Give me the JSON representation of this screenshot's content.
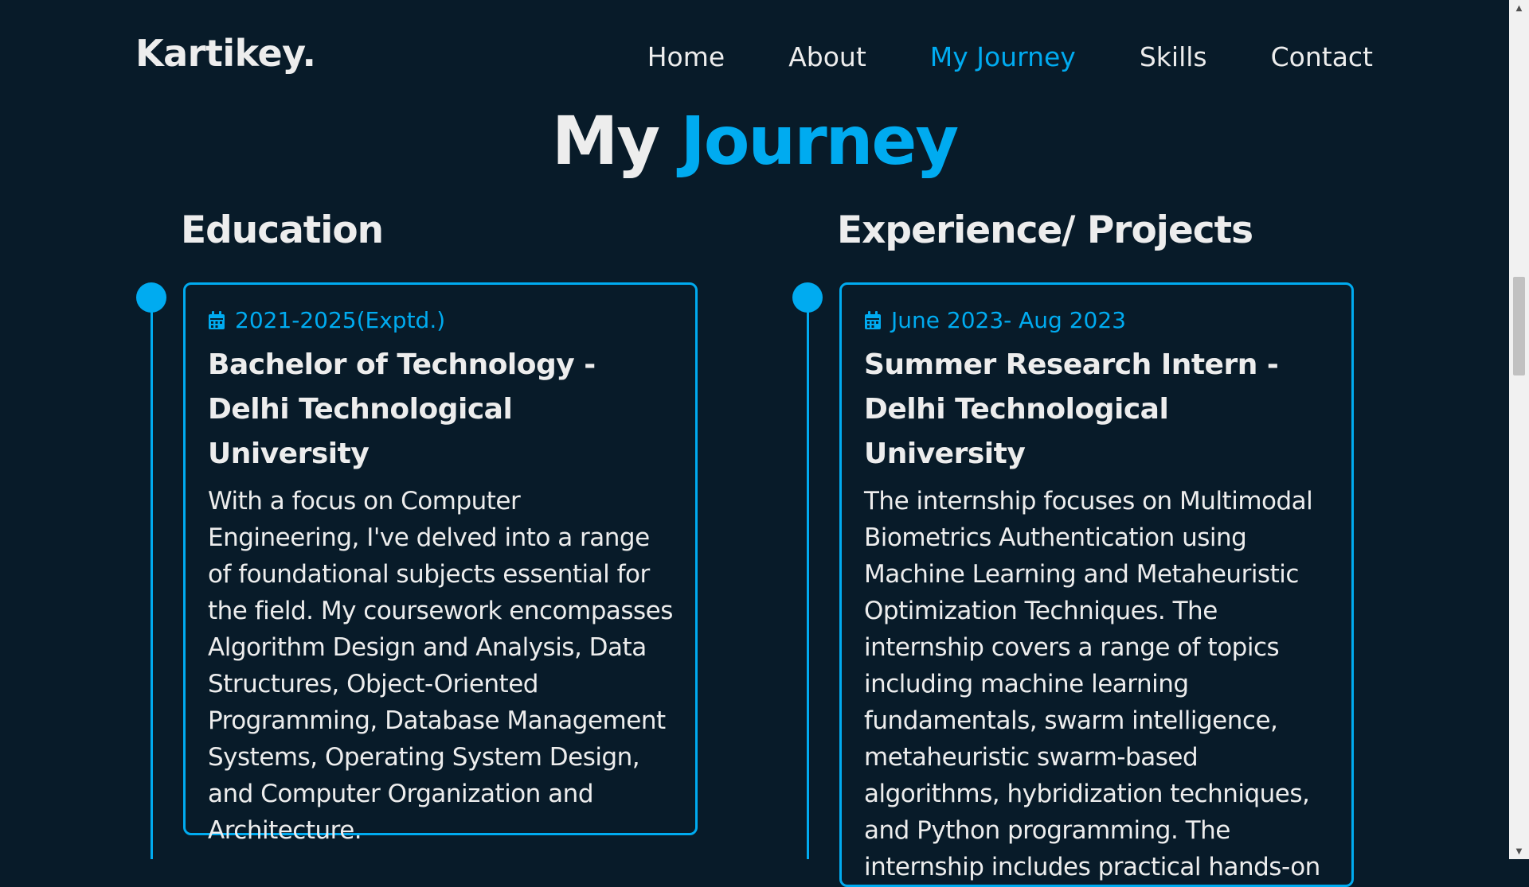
{
  "brand": "Kartikey.",
  "nav": [
    {
      "label": "Home"
    },
    {
      "label": "About"
    },
    {
      "label": "My Journey",
      "active": true
    },
    {
      "label": "Skills"
    },
    {
      "label": "Contact"
    }
  ],
  "heading": {
    "part1": "My",
    "part2": "Journey"
  },
  "education": {
    "title": "Education",
    "items": [
      {
        "date": "2021-2025(Exptd.)",
        "title": "Bachelor of Technology - Delhi Technological University",
        "text": "With a focus on Computer Engineering, I've delved into a range of foundational subjects essential for the field. My coursework encompasses Algorithm Design and Analysis, Data Structures, Object-Oriented Programming, Database Management Systems, Operating System Design, and Computer Organization and Architecture."
      }
    ]
  },
  "experience": {
    "title": "Experience/ Projects",
    "items": [
      {
        "date": "June 2023- Aug 2023",
        "title": "Summer Research Intern - Delhi Technological University",
        "text": "The internship focuses on Multimodal Biometrics Authentication using Machine Learning and Metaheuristic Optimization Techniques. The internship covers a range of topics including machine learning fundamentals, swarm intelligence, metaheuristic swarm-based algorithms, hybridization techniques, and Python programming. The internship includes practical hands-on"
      }
    ]
  },
  "icons": {
    "date": "calendar-icon"
  },
  "colors": {
    "background": "#081b29",
    "accent": "#00abf0",
    "text": "#ededed"
  }
}
